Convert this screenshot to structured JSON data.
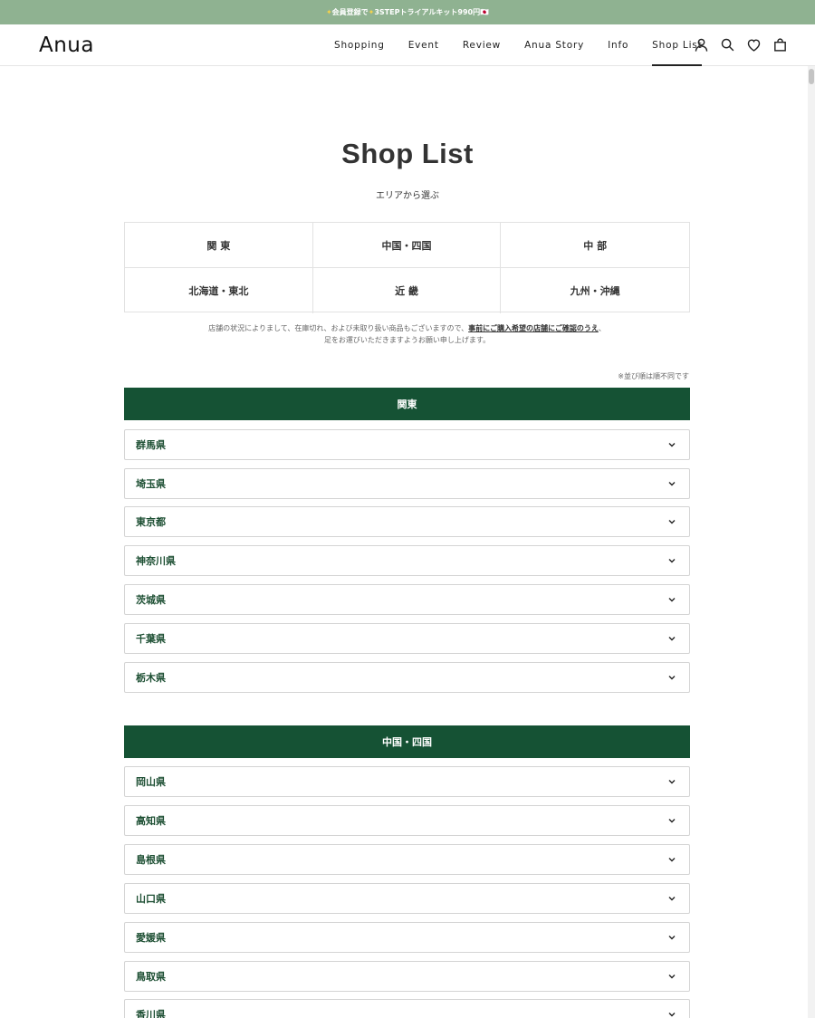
{
  "announcement": {
    "star_left": "✦",
    "text": "会員登録で",
    "star_mid": "✦",
    "text2": "3STEPトライアルキット990円",
    "flag": "🇯🇵"
  },
  "header": {
    "logo": "Anua",
    "nav": [
      "Shopping",
      "Event",
      "Review",
      "Anua Story",
      "Info",
      "Shop List"
    ],
    "active_nav": "Shop List",
    "icons": [
      "account-icon",
      "search-icon",
      "wishlist-heart-icon",
      "cart-bag-icon"
    ]
  },
  "page": {
    "title": "Shop List",
    "subtitle": "エリアから選ぶ",
    "areas": [
      "関 東",
      "中国・四国",
      "中 部",
      "北海道・東北",
      "近 畿",
      "九州・沖縄"
    ],
    "notice_line1_a": "店舗の状況によりまして、在庫切れ、および未取り扱い商品もございますので、",
    "notice_line1_emph": "事前にご購入希望の店舗にご確認のうえ",
    "notice_line1_b": "、",
    "notice_line2": "足をお運びいただきますようお願い申し上げます。",
    "sort_note": "※並び順は順不同です"
  },
  "regions": [
    {
      "name": "関東",
      "prefectures": [
        "群馬県",
        "埼玉県",
        "東京都",
        "神奈川県",
        "茨城県",
        "千葉県",
        "栃木県"
      ]
    },
    {
      "name": "中国・四国",
      "prefectures": [
        "岡山県",
        "高知県",
        "島根県",
        "山口県",
        "愛媛県",
        "鳥取県",
        "香川県"
      ]
    }
  ],
  "colors": {
    "announcement_bg": "#8fb291",
    "region_header_bg": "#155234",
    "prefecture_text": "#1d4f33"
  }
}
